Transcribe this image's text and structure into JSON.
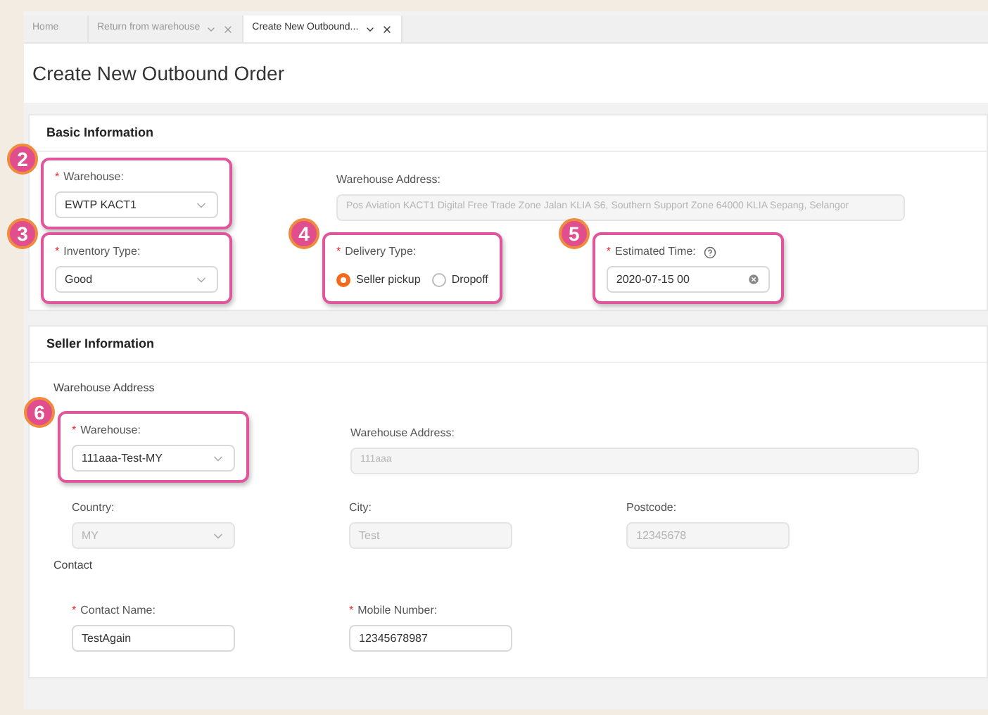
{
  "tabs": [
    {
      "label": "Home",
      "selected": false,
      "closable": false
    },
    {
      "label": "Return from warehouse",
      "selected": false,
      "closable": true
    },
    {
      "label": "Create New Outbound...",
      "selected": true,
      "closable": true
    }
  ],
  "page_title": "Create New Outbound Order",
  "sections": [
    {
      "title": "Basic Information",
      "groups": [
        {
          "rows": [
            [
              {
                "kind": "select",
                "asterisk": "*",
                "label": "Warehouse:",
                "value": "EWTP KACT1",
                "disabled": false,
                "callout": "2"
              },
              {
                "kind": "address",
                "label": "Warehouse Address:",
                "value": "Pos Aviation KACT1 Digital Free Trade Zone Jalan KLIA S6, Southern Support Zone  64000 KLIA Sepang, Selangor",
                "disabled": true
              }
            ],
            [
              {
                "kind": "select",
                "asterisk": "*",
                "label": "Inventory Type:",
                "value": "Good",
                "disabled": false,
                "callout": "3"
              },
              {
                "kind": "radio",
                "asterisk": "*",
                "label": "Delivery Type:",
                "options": [
                  {
                    "label": "Seller pickup",
                    "selected": true
                  },
                  {
                    "label": "Dropoff",
                    "selected": false
                  }
                ],
                "callout": "4"
              },
              {
                "kind": "date",
                "asterisk": "*",
                "label": "Estimated Time:",
                "value": "2020-07-15 00",
                "callout": "5"
              }
            ]
          ]
        }
      ]
    },
    {
      "title": "Seller Information",
      "groups": [
        {
          "subtitle": "Warehouse Address",
          "rows": [
            [
              {
                "kind": "select",
                "asterisk": "*",
                "label": "Warehouse:",
                "value": "111aaa-Test-MY",
                "disabled": false,
                "callout": "6"
              },
              {
                "kind": "address",
                "label": "Warehouse Address:",
                "value": "111aaa",
                "disabled": true
              }
            ],
            [
              {
                "kind": "select",
                "label": "Country:",
                "value": "MY",
                "disabled": true
              },
              {
                "kind": "input",
                "label": "City:",
                "value": "Test",
                "disabled": true
              },
              {
                "kind": "input",
                "label": "Postcode:",
                "value": "12345678",
                "disabled": true
              }
            ]
          ]
        },
        {
          "subtitle": "Contact",
          "rows": [
            [
              {
                "kind": "input",
                "asterisk": "*",
                "label": "Contact Name:",
                "value": "TestAgain",
                "disabled": false
              },
              {
                "kind": "input",
                "asterisk": "*",
                "label": "Mobile Number:",
                "value": "12345678987",
                "disabled": false
              }
            ]
          ]
        }
      ]
    }
  ]
}
